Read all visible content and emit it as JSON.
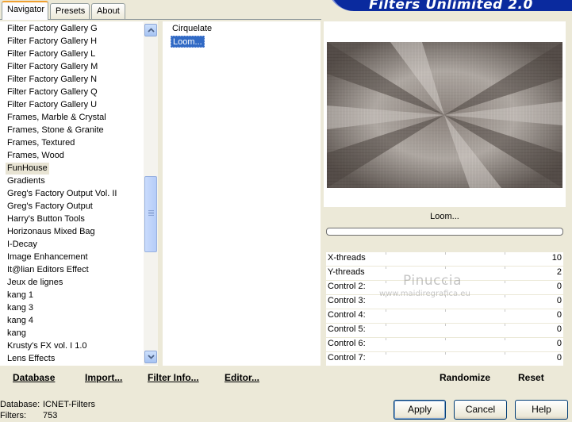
{
  "tabs": [
    "Navigator",
    "Presets",
    "About"
  ],
  "banner_title": "Filters Unlimited 2.0",
  "categories": [
    "Filter Factory Gallery G",
    "Filter Factory Gallery H",
    "Filter Factory Gallery L",
    "Filter Factory Gallery M",
    "Filter Factory Gallery N",
    "Filter Factory Gallery Q",
    "Filter Factory Gallery U",
    "Frames, Marble & Crystal",
    "Frames, Stone & Granite",
    "Frames, Textured",
    "Frames, Wood",
    "FunHouse",
    "Gradients",
    "Greg's Factory Output Vol. II",
    "Greg's Factory Output",
    "Harry's Button Tools",
    "Horizonaus Mixed Bag",
    "I-Decay",
    "Image Enhancement",
    "It@lian Editors Effect",
    "Jeux de lignes",
    "kang 1",
    "kang 3",
    "kang 4",
    "kang",
    "Krusty's FX vol. I 1.0",
    "Lens Effects"
  ],
  "selected_category": "FunHouse",
  "filters": [
    "Cirquelate",
    "Loom..."
  ],
  "selected_filter": "Loom...",
  "preview_label": "Loom...",
  "progress": 0,
  "controls": [
    {
      "name": "X-threads",
      "value": "10"
    },
    {
      "name": "Y-threads",
      "value": "2"
    },
    {
      "name": "Control 2:",
      "value": "0"
    },
    {
      "name": "Control 3:",
      "value": "0"
    },
    {
      "name": "Control 4:",
      "value": "0"
    },
    {
      "name": "Control 5:",
      "value": "0"
    },
    {
      "name": "Control 6:",
      "value": "0"
    },
    {
      "name": "Control 7:",
      "value": "0"
    }
  ],
  "toolbar": {
    "database": "Database",
    "import": "Import...",
    "filter_info": "Filter Info...",
    "editor": "Editor...",
    "randomize": "Randomize",
    "reset": "Reset"
  },
  "status": {
    "database_label": "Database:",
    "database_value": "ICNET-Filters",
    "filters_label": "Filters:",
    "filters_value": "753"
  },
  "buttons": {
    "apply": "Apply",
    "cancel": "Cancel",
    "help": "Help"
  },
  "watermark": {
    "name": "Pinuccia",
    "url": "www.maidiregrafica.eu"
  },
  "colors": {
    "accent": "#316ac5",
    "banner": "#0a2a9e",
    "window_bg": "#ece9d8"
  }
}
